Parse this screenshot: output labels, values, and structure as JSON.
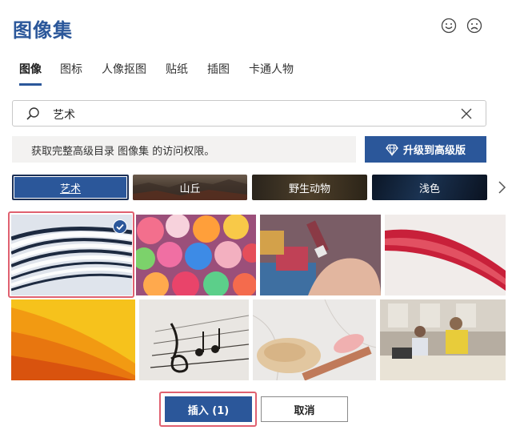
{
  "dialog": {
    "title": "图像集"
  },
  "tabs": [
    {
      "label": "图像",
      "active": true
    },
    {
      "label": "图标",
      "active": false
    },
    {
      "label": "人像抠图",
      "active": false
    },
    {
      "label": "贴纸",
      "active": false
    },
    {
      "label": "插图",
      "active": false
    },
    {
      "label": "卡通人物",
      "active": false
    }
  ],
  "search": {
    "value": "艺术",
    "icon": "search-icon",
    "clear_icon": "close-icon"
  },
  "notice": {
    "text": "获取完整高级目录 图像集 的访问权限。"
  },
  "upgrade_button": {
    "label": "升级到高级版",
    "icon": "diamond-icon"
  },
  "categories": [
    {
      "label": "艺术",
      "selected": true
    },
    {
      "label": "山丘",
      "selected": false
    },
    {
      "label": "野生动物",
      "selected": false
    },
    {
      "label": "浅色",
      "selected": false
    }
  ],
  "images": [
    {
      "subject": "abstract white waves",
      "selected": true
    },
    {
      "subject": "colorful buttons",
      "selected": false
    },
    {
      "subject": "paint tube in hand",
      "selected": false
    },
    {
      "subject": "red ribbon curve",
      "selected": false
    },
    {
      "subject": "yellow orange paper",
      "selected": false
    },
    {
      "subject": "music notes",
      "selected": false
    },
    {
      "subject": "powder and brush on marble",
      "selected": false
    },
    {
      "subject": "people working at table",
      "selected": false
    }
  ],
  "buttons": {
    "insert": "插入 (1)",
    "cancel": "取消"
  },
  "colors": {
    "accent": "#2b579a",
    "selection": "#e06170"
  }
}
